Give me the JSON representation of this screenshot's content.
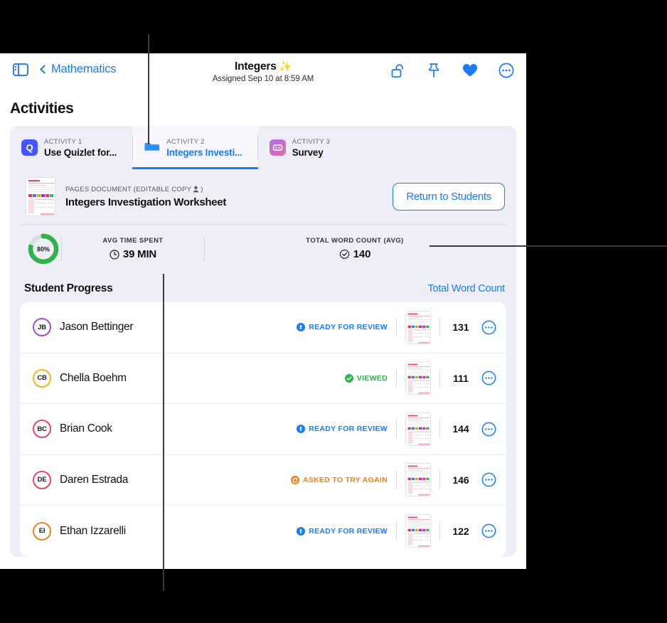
{
  "toolbar": {
    "back_label": "Mathematics",
    "title": "Integers",
    "title_sparkle": "✨",
    "subtitle": "Assigned Sep 10 at 8:59 AM",
    "icons": [
      "sidebar-toggle-icon",
      "lock-open-icon",
      "pin-icon",
      "heart-icon",
      "more-circle-icon"
    ]
  },
  "page": {
    "heading": "Activities"
  },
  "activities": [
    {
      "kicker": "ACTIVITY 1",
      "name": "Use Quizlet for...",
      "icon": "quizlet-icon",
      "active": false
    },
    {
      "kicker": "ACTIVITY 2",
      "name": "Integers Investi...",
      "icon": "folder-icon",
      "active": true
    },
    {
      "kicker": "ACTIVITY 3",
      "name": "Survey",
      "icon": "survey-icon",
      "active": false
    }
  ],
  "document": {
    "kicker": "PAGES DOCUMENT (EDITABLE COPY",
    "kicker_suffix": ")",
    "person_icon": "person-icon",
    "name": "Integers Investigation Worksheet",
    "return_button": "Return to Students"
  },
  "stats": {
    "ring_percent": "80%",
    "ring_value": 80,
    "ring_color": "#2fb34a",
    "time": {
      "kicker": "AVG TIME SPENT",
      "value": "39 MIN",
      "icon": "clock-icon"
    },
    "words": {
      "kicker": "TOTAL WORD COUNT (AVG)",
      "value": "140",
      "icon": "seal-check-icon"
    }
  },
  "student_progress": {
    "title": "Student Progress",
    "link": "Total Word Count",
    "status_colors": {
      "ready": "#1b7cf5",
      "viewed": "#2fb34a",
      "retry": "#f58220"
    },
    "rows": [
      {
        "initials": "JB",
        "name": "Jason Bettinger",
        "ring": "#a24fd0",
        "status": "READY FOR REVIEW",
        "status_type": "ready",
        "words": "131"
      },
      {
        "initials": "CB",
        "name": "Chella Boehm",
        "ring": "#f0b429",
        "status": "VIEWED",
        "status_type": "viewed",
        "words": "111"
      },
      {
        "initials": "BC",
        "name": "Brian Cook",
        "ring": "#f0426b",
        "status": "READY FOR REVIEW",
        "status_type": "ready",
        "words": "144"
      },
      {
        "initials": "DE",
        "name": "Daren Estrada",
        "ring": "#f0426b",
        "status": "ASKED TO TRY AGAIN",
        "status_type": "retry",
        "words": "146"
      },
      {
        "initials": "EI",
        "name": "Ethan Izzarelli",
        "ring": "#f58220",
        "status": "READY FOR REVIEW",
        "status_type": "ready",
        "words": "122"
      }
    ]
  }
}
